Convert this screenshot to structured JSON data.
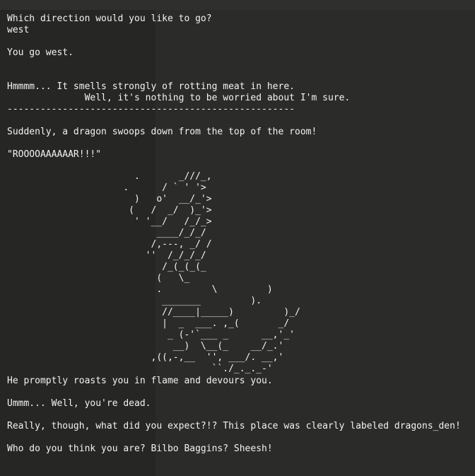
{
  "terminal": {
    "prompt": "Which direction would you like to go?",
    "input": "west",
    "move": "You go west.",
    "smell1": "Hmmmm... It smells strongly of rotting meat in here.",
    "smell2": "              Well, it's nothing to be worried about I'm sure.",
    "divider": "----------------------------------------------------",
    "dragon_intro": "Suddenly, a dragon swoops down from the top of the room!",
    "roar": "\"ROOOOAAAAAAR!!!\"",
    "dragon_art": "                       .       _///_,\n                     .      / ` ' '>\n                       )   o'  __/_'>\n                      (   /  _/  )_'>\n                       ' '__/   /_/_>\n                           ____/_/_/\n                          /,---, _/ /\n                         ''  /_/_/_/\n                            /_(_(_(_\n                           (   \\_\n                           .         \\         )\n                            _______         ).\n                            //____|_____)         )_/\n                            |  _  ___. ,_(       _/\n                             _ (-'`___ _      __,'_'\n                              __)  \\__(_    __/_.'\n                          ,((,-,__  '', ___/. __,'\n                                     ``./_._._-'",
    "roasted": "He promptly roasts you in flame and devours you.",
    "dead": "Ummm... Well, you're dead.",
    "expect": "Really, though, what did you expect?!? This place was clearly labeled dragons_den!",
    "bilbo": "Who do you think you are? Bilbo Baggins? Sheesh!"
  }
}
